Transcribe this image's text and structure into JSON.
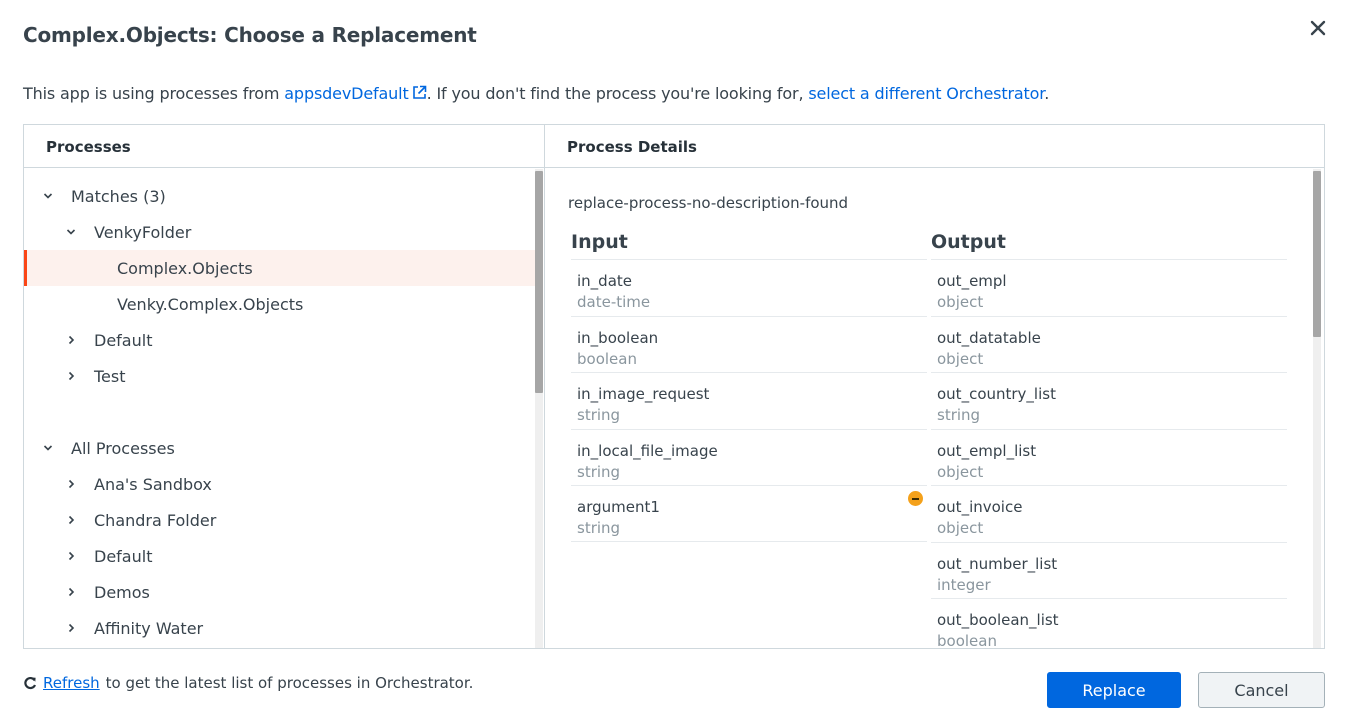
{
  "dialog": {
    "title": "Complex.Objects: Choose a Replacement"
  },
  "intro": {
    "prefix": "This app is using processes from ",
    "orchestrator_link": "appsdevDefault",
    "middle": ". If you don't find the process you're looking for, ",
    "select_link": "select a different Orchestrator",
    "suffix": "."
  },
  "processes": {
    "header": "Processes",
    "tree": [
      {
        "label": "Matches (3)",
        "level": 0,
        "expanded": true
      },
      {
        "label": "VenkyFolder",
        "level": 1,
        "expanded": true
      },
      {
        "label": "Complex.Objects",
        "level": 2,
        "selected": true
      },
      {
        "label": "Venky.Complex.Objects",
        "level": 2
      },
      {
        "label": "Default",
        "level": 1,
        "expanded": false
      },
      {
        "label": "Test",
        "level": 1,
        "expanded": false
      },
      {
        "label": "All Processes",
        "level": 0,
        "expanded": true
      },
      {
        "label": "Ana's Sandbox",
        "level": 1,
        "expanded": false
      },
      {
        "label": "Chandra Folder",
        "level": 1,
        "expanded": false
      },
      {
        "label": "Default",
        "level": 1,
        "expanded": false
      },
      {
        "label": "Demos",
        "level": 1,
        "expanded": false
      },
      {
        "label": "Affinity Water",
        "level": 1,
        "expanded": false
      }
    ]
  },
  "details": {
    "header": "Process Details",
    "description": "replace-process-no-description-found",
    "input_title": "Input",
    "output_title": "Output",
    "inputs": [
      {
        "name": "in_date",
        "type": "date-time"
      },
      {
        "name": "in_boolean",
        "type": "boolean"
      },
      {
        "name": "in_image_request",
        "type": "string"
      },
      {
        "name": "in_local_file_image",
        "type": "string"
      },
      {
        "name": "argument1",
        "type": "string",
        "warning": true
      }
    ],
    "outputs": [
      {
        "name": "out_empl",
        "type": "object"
      },
      {
        "name": "out_datatable",
        "type": "object"
      },
      {
        "name": "out_country_list",
        "type": "string"
      },
      {
        "name": "out_empl_list",
        "type": "object"
      },
      {
        "name": "out_invoice",
        "type": "object"
      },
      {
        "name": "out_number_list",
        "type": "integer"
      },
      {
        "name": "out_boolean_list",
        "type": "boolean"
      }
    ]
  },
  "footer": {
    "refresh_link": "Refresh",
    "refresh_text": "to get the latest list of processes in Orchestrator.",
    "replace_label": "Replace",
    "cancel_label": "Cancel"
  },
  "colors": {
    "accent": "#0067df",
    "selection": "#fa4616",
    "warning": "#f4a11b"
  }
}
